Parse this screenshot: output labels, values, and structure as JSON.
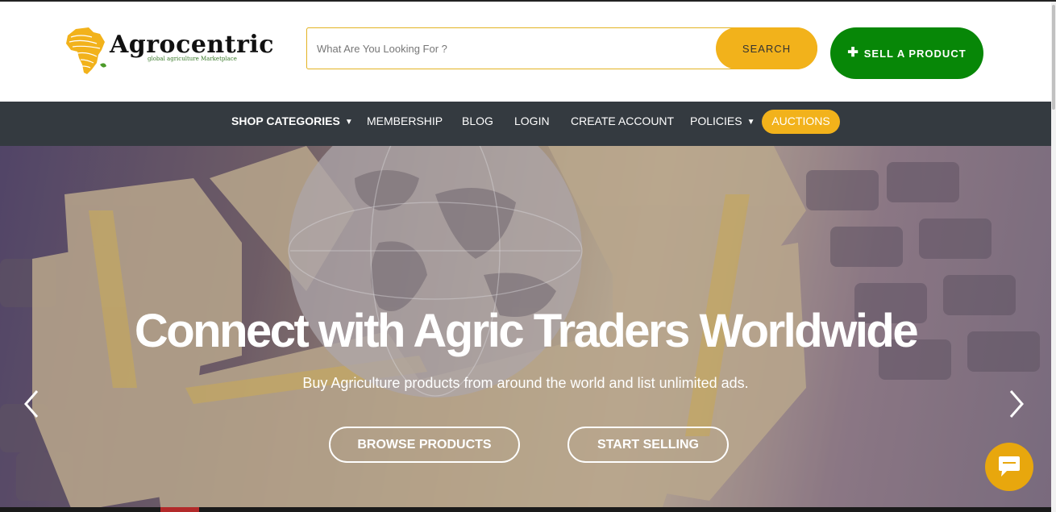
{
  "brand": {
    "name": "Agrocentric",
    "tagline": "global agriculture Marketplace",
    "accent": "#f2b21b",
    "green": "#078707"
  },
  "search": {
    "placeholder": "What Are You Looking For ?",
    "button_label": "SEARCH"
  },
  "sell": {
    "label": "SELL A PRODUCT",
    "icon": "plus-icon"
  },
  "nav": {
    "items": [
      {
        "label": "SHOP CATEGORIES",
        "dropdown": true
      },
      {
        "label": "MEMBERSHIP"
      },
      {
        "label": "BLOG"
      },
      {
        "label": "LOGIN"
      },
      {
        "label": "CREATE ACCOUNT"
      },
      {
        "label": "POLICIES",
        "dropdown": true
      }
    ],
    "highlight": "AUCTIONS"
  },
  "hero": {
    "title": "Connect with Agric Traders Worldwide",
    "subtitle": "Buy Agriculture products from around the world and list unlimited ads.",
    "buttons": [
      "BROWSE PRODUCTS",
      "START SELLING"
    ],
    "prev_icon": "chevron-left-icon",
    "next_icon": "chevron-right-icon"
  },
  "chat": {
    "icon": "chat-bubble-icon"
  }
}
